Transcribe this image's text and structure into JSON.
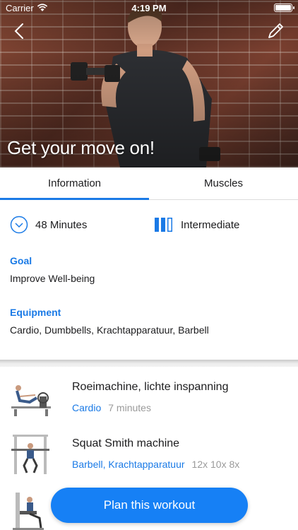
{
  "status": {
    "carrier": "Carrier",
    "time": "4:19 PM"
  },
  "hero": {
    "title": "Get your move on!"
  },
  "tabs": [
    {
      "label": "Information",
      "active": true
    },
    {
      "label": "Muscles",
      "active": false
    }
  ],
  "info": {
    "duration": "48 Minutes",
    "level": "Intermediate",
    "goal_label": "Goal",
    "goal_value": "Improve Well-being",
    "equipment_label": "Equipment",
    "equipment_value": "Cardio, Dumbbells, Krachtapparatuur, Barbell"
  },
  "exercises": [
    {
      "name": "Roeimachine, lichte inspanning",
      "category": "Cardio",
      "detail": "7 minutes"
    },
    {
      "name": "Squat Smith machine",
      "category": "Barbell, Krachtapparatuur",
      "detail": "12x 10x 8x"
    }
  ],
  "cta": {
    "label": "Plan this workout"
  },
  "colors": {
    "accent": "#1a7ae6",
    "button": "#1680f5"
  }
}
